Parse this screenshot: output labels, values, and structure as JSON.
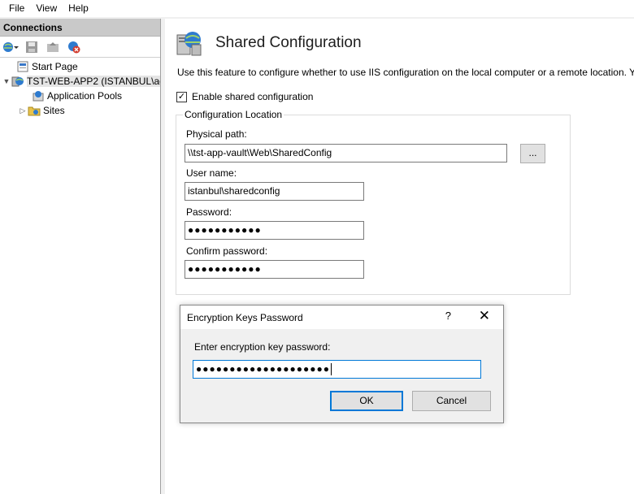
{
  "menu": {
    "file": "File",
    "view": "View",
    "help": "Help"
  },
  "connections": {
    "header": "Connections",
    "tree": {
      "start_page": "Start Page",
      "server": "TST-WEB-APP2 (ISTANBUL\\ad",
      "app_pools": "Application Pools",
      "sites": "Sites"
    }
  },
  "feature": {
    "title": "Shared Configuration",
    "description": "Use this feature to configure whether to use IIS configuration on the local computer or a remote location. Y",
    "enable_label": "Enable shared configuration",
    "enable_checked": true,
    "group_title": "Configuration Location",
    "physical_path_label": "Physical path:",
    "physical_path_value": "\\\\tst-app-vault\\Web\\SharedConfig",
    "browse_label": "...",
    "username_label": "User name:",
    "username_value": "istanbul\\sharedconfig",
    "password_label": "Password:",
    "password_value": "●●●●●●●●●●●",
    "confirm_label": "Confirm password:",
    "confirm_value": "●●●●●●●●●●●"
  },
  "dialog": {
    "title": "Encryption Keys Password",
    "help": "?",
    "close": "✕",
    "prompt": "Enter encryption key password:",
    "value": "●●●●●●●●●●●●●●●●●●●●",
    "ok": "OK",
    "cancel": "Cancel"
  }
}
